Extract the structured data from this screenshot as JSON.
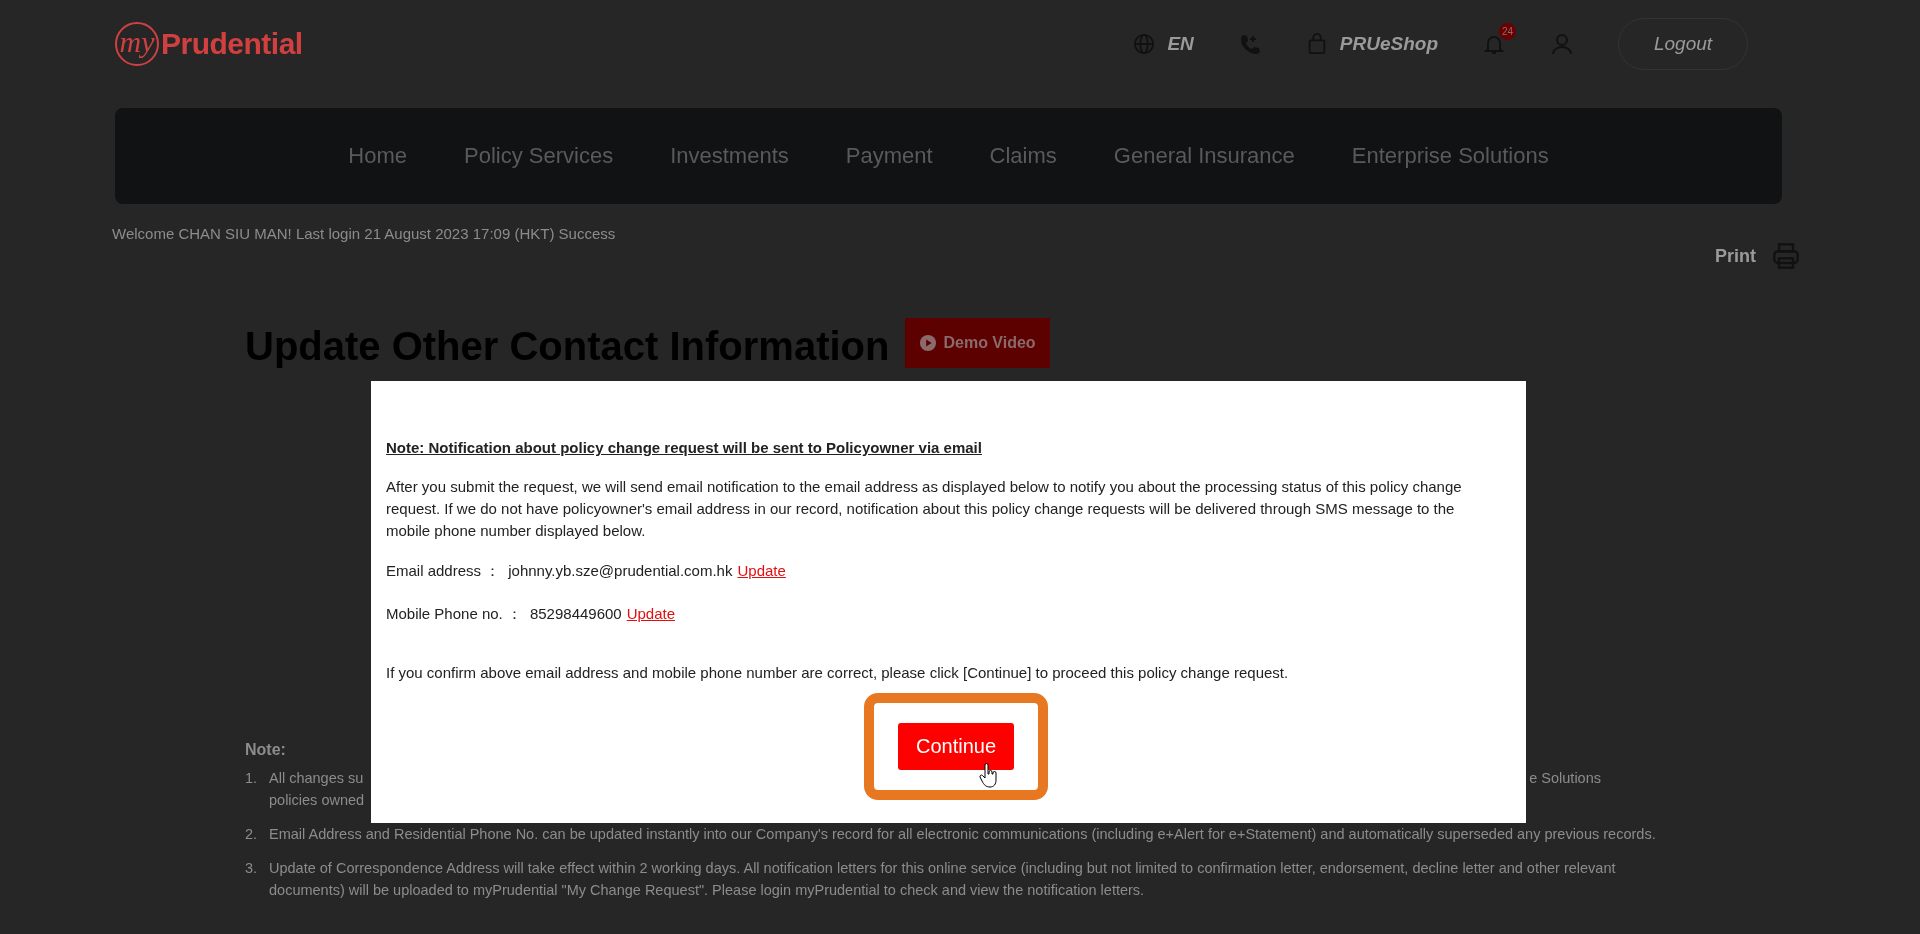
{
  "header": {
    "logo": {
      "prefix": "my",
      "name": "Prudential"
    },
    "language": "EN",
    "shop": "PRUeShop",
    "notifications_badge": "24",
    "logout": "Logout"
  },
  "nav": {
    "items": [
      {
        "label": "Home"
      },
      {
        "label": "Policy Services"
      },
      {
        "label": "Investments"
      },
      {
        "label": "Payment"
      },
      {
        "label": "Claims"
      },
      {
        "label": "General Insurance"
      },
      {
        "label": "Enterprise Solutions"
      }
    ]
  },
  "welcome": "Welcome CHAN SIU MAN! Last login 21 August 2023 17:09 (HKT) Success",
  "print": "Print",
  "page_title": "Update Other Contact Information",
  "demo_video": "Demo Video",
  "notes": {
    "heading": "Note:",
    "items": [
      {
        "kind": "partial",
        "number": "1.",
        "left_lines": [
          "All changes su",
          "policies owned"
        ],
        "right_text": "e Solutions"
      },
      {
        "kind": "full",
        "number": "2.",
        "text": "Email Address and Residential Phone No. can be updated instantly into our Company's record for all electronic communications (including e+Alert for e+Statement) and automatically superseded any previous records."
      },
      {
        "kind": "full",
        "number": "3.",
        "text": "Update of Correspondence Address will take effect within 2 working days. All notification letters for this online service (including but not limited to confirmation letter, endorsement, decline letter and other relevant documents) will be uploaded to myPrudential \"My Change Request\". Please login myPrudential to check and view the notification letters."
      }
    ]
  },
  "modal": {
    "heading": "Note: Notification about policy change request will be sent to Policyowner via email",
    "paragraph": "After you submit the request, we will send email notification to the email address as displayed below to notify you about the processing status of this policy change request. If we do not have policyowner's email address in our record, notification about this policy change requests will be delivered through SMS message to the mobile phone number displayed below.",
    "fields": [
      {
        "label": "Email address ：",
        "value": "johnny.yb.sze@prudential.com.hk",
        "link": "Update"
      },
      {
        "label": "Mobile Phone no. ：",
        "value": "85298449600",
        "link": "Update"
      }
    ],
    "confirm": "If you confirm above email address and mobile phone number are correct, please click [Continue] to proceed this policy change request.",
    "button": {
      "label": "Continue",
      "highlighted": true
    }
  }
}
